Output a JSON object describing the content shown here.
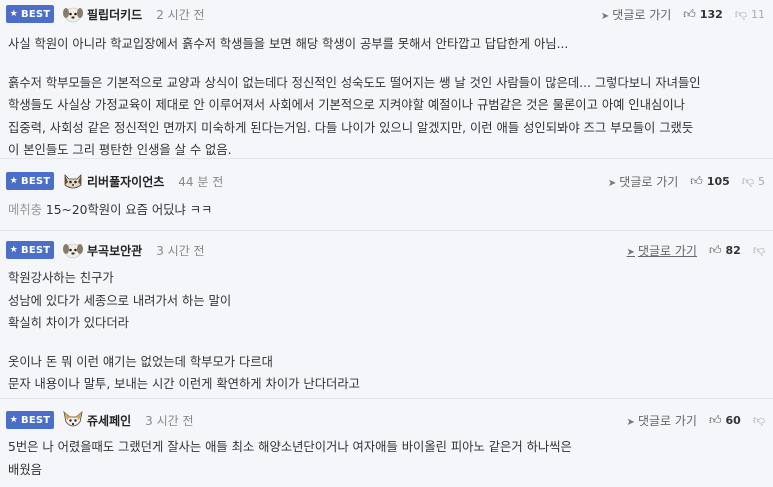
{
  "labels": {
    "best": "BEST",
    "reply": "댓글로 가기"
  },
  "comments": [
    {
      "avatar": "puppy-avatar",
      "nick": "필립더키드",
      "time": "2 시간 전",
      "likes": "132",
      "dislikes": "11",
      "lines": [
        "사실 학원이 아니라 학교입장에서 흙수저 학생들을 보면 해당 학생이 공부를 못해서 안타깝고 답답한게 아님...",
        "",
        "흙수저 학부모들은 기본적으로 교양과 상식이 없는데다 정신적인 성숙도도 떨어지는 쌩 날 것인 사람들이 많은데... 그렇다보니 자녀들인",
        "학생들도 사실상 가정교육이 제대로 안 이루어져서 사회에서 기본적으로 지켜야할 예절이나 규범같은 것은 물론이고 아예 인내심이나",
        "집중력, 사회성 같은 정신적인 면까지 미숙하게 된다는거임. 다들 나이가 있으니 알겠지만, 이런 애들 성인되봐야 즈그 부모들이 그랬듯",
        "이 본인들도 그리 평탄한 인생을 살 수 없음."
      ]
    },
    {
      "avatar": "cat-avatar",
      "nick": "리버풀자이언츠",
      "time": "44 분 전",
      "likes": "105",
      "dislikes": "5",
      "prefix": "메취충",
      "lines": [
        "15~20학원이 요즘 어딨냐 ㅋㅋ"
      ]
    },
    {
      "avatar": "puppy-avatar",
      "nick": "부곡보안관",
      "time": "3 시간 전",
      "likes": "82",
      "dislikes": "",
      "lines": [
        "학원강사하는 친구가",
        "성남에 있다가 세종으로 내려가서 하는 말이",
        "확실히 차이가 있다더라",
        "",
        "옷이나 돈 뭐 이런 얘기는 없었는데 학부모가 다르대",
        "문자 내용이나 말투, 보내는 시간 이런게 확연하게 차이가 난다더라고"
      ]
    },
    {
      "avatar": "dog-avatar",
      "nick": "쥬세페인",
      "time": "3 시간 전",
      "likes": "60",
      "dislikes": "",
      "lines": [
        "5번은 나 어렸을때도 그랬던게 잘사는 애들 최소 해양소년단이거나 여자애들 바이올린 피아노 같은거 하나씩은",
        "배웠음"
      ]
    }
  ]
}
